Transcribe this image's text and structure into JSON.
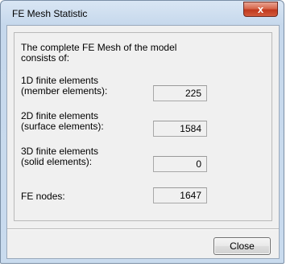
{
  "window": {
    "title": "FE Mesh Statistic",
    "close_glyph": "x"
  },
  "intro": {
    "line1": "The complete FE Mesh of the model",
    "line2": "consists of:"
  },
  "rows": [
    {
      "label_line1": "1D finite elements",
      "label_line2": "(member elements):",
      "value": "225"
    },
    {
      "label_line1": "2D finite elements",
      "label_line2": "(surface elements):",
      "value": "1584"
    },
    {
      "label_line1": "3D finite elements",
      "label_line2": "(solid elements):",
      "value": "0"
    },
    {
      "label_line1": "FE nodes:",
      "label_line2": "",
      "value": "1647"
    }
  ],
  "buttons": {
    "close_label": "Close"
  }
}
